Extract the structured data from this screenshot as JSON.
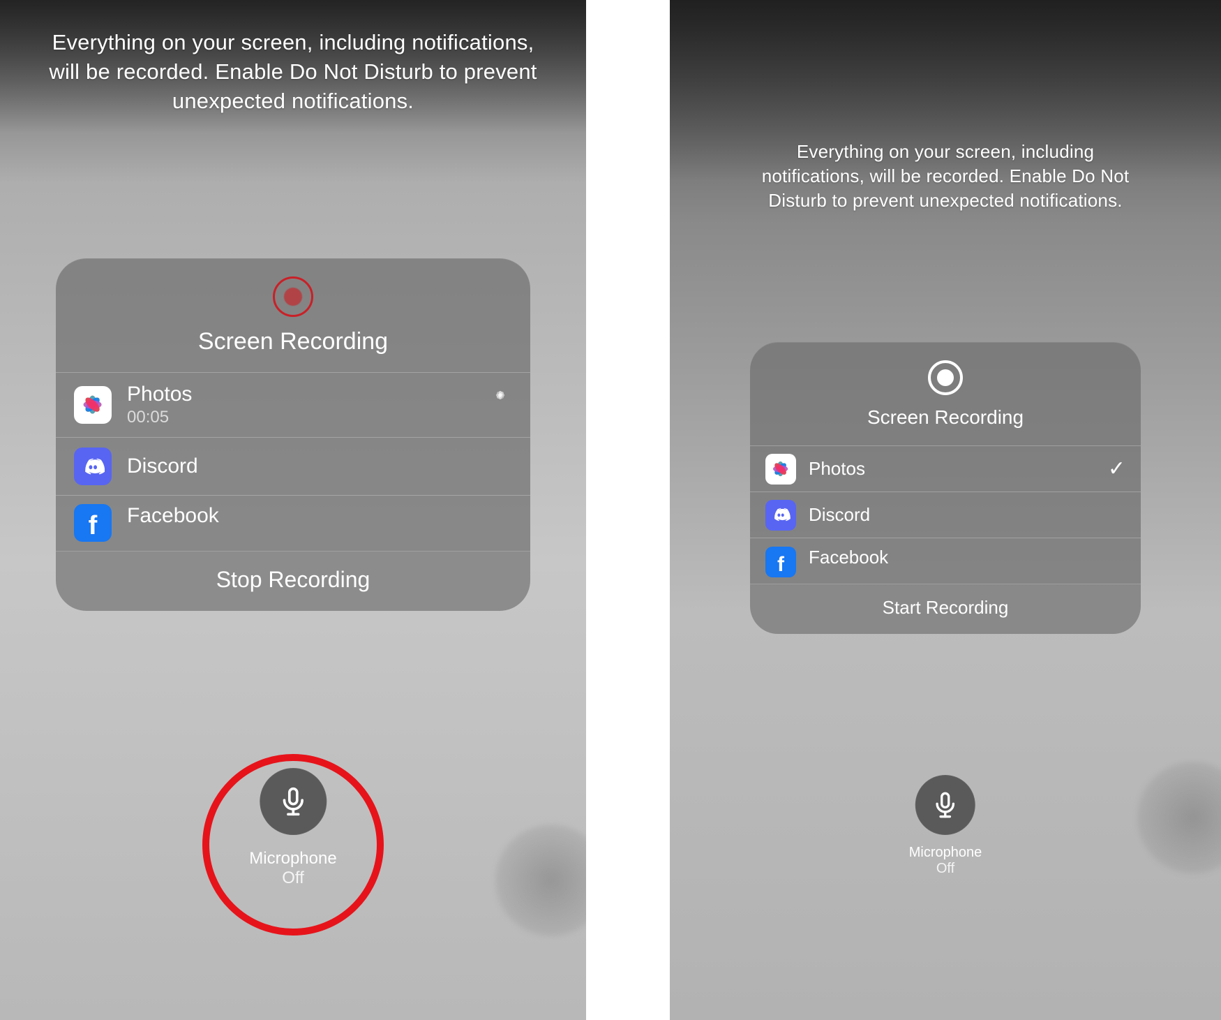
{
  "left": {
    "notice": "Everything on your screen, including notifications, will be recorded. Enable Do Not Disturb to prevent unexpected notifications.",
    "card": {
      "title": "Screen Recording",
      "options": [
        {
          "app": "Photos",
          "subtitle": "00:05",
          "status": "loading"
        },
        {
          "app": "Discord"
        },
        {
          "app": "Facebook"
        }
      ],
      "action": "Stop Recording"
    },
    "mic": {
      "label": "Microphone",
      "state": "Off"
    },
    "highlight": true
  },
  "right": {
    "notice": "Everything on your screen, including notifications, will be recorded. Enable Do Not Disturb to prevent unexpected notifications.",
    "card": {
      "title": "Screen Recording",
      "options": [
        {
          "app": "Photos",
          "status": "selected"
        },
        {
          "app": "Discord"
        },
        {
          "app": "Facebook"
        }
      ],
      "action": "Start Recording"
    },
    "mic": {
      "label": "Microphone",
      "state": "Off"
    }
  }
}
